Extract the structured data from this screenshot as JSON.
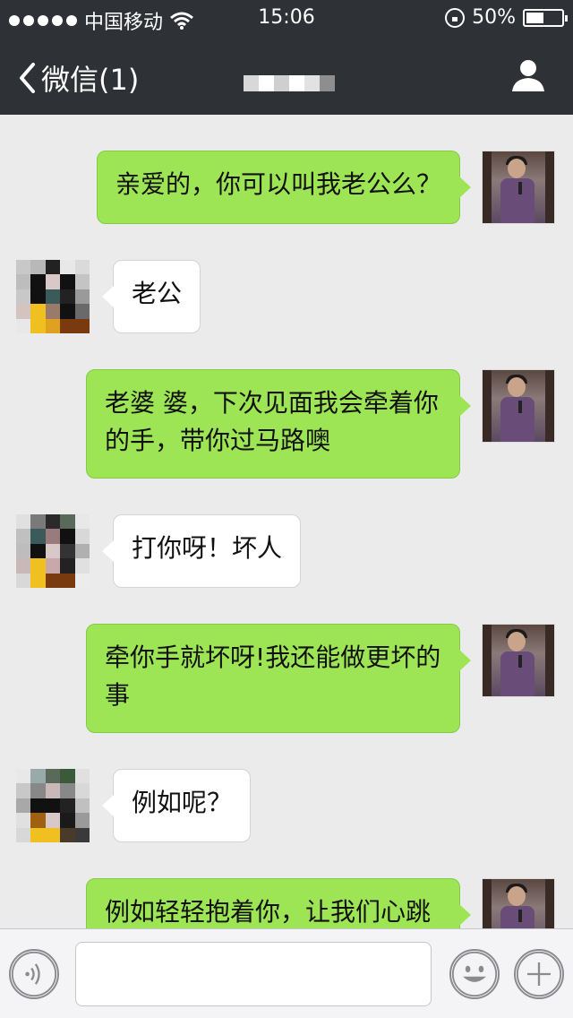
{
  "status_bar": {
    "carrier": "中国移动",
    "time": "15:06",
    "battery": "50%",
    "battery_level": 0.5,
    "icons": [
      "signal-dots-icon",
      "wifi-icon",
      "rotation-lock-icon",
      "battery-icon"
    ]
  },
  "nav": {
    "back_label": "微信(1)",
    "contact_icon": "person-icon"
  },
  "messages": [
    {
      "direction": "out",
      "text": "亲爱的，你可以叫我老公么？"
    },
    {
      "direction": "in",
      "text": "老公"
    },
    {
      "direction": "out",
      "text": "老婆 婆，下次见面我会牵着你的手，带你过马路噢"
    },
    {
      "direction": "in",
      "text": "打你呀！坏人"
    },
    {
      "direction": "out",
      "text": "牵你手就坏呀!我还能做更坏的事"
    },
    {
      "direction": "in",
      "text": "例如呢？"
    },
    {
      "direction": "out",
      "text": "例如轻轻抱着你，让我们心跳"
    }
  ],
  "input_bar": {
    "value": "",
    "placeholder": "",
    "icons": [
      "voice-icon",
      "emoji-icon",
      "plus-icon"
    ]
  },
  "colors": {
    "nav_bg": "#2e3136",
    "chat_bg": "#ebebeb",
    "outgoing_bubble": "#9de554",
    "incoming_bubble": "#ffffff"
  }
}
